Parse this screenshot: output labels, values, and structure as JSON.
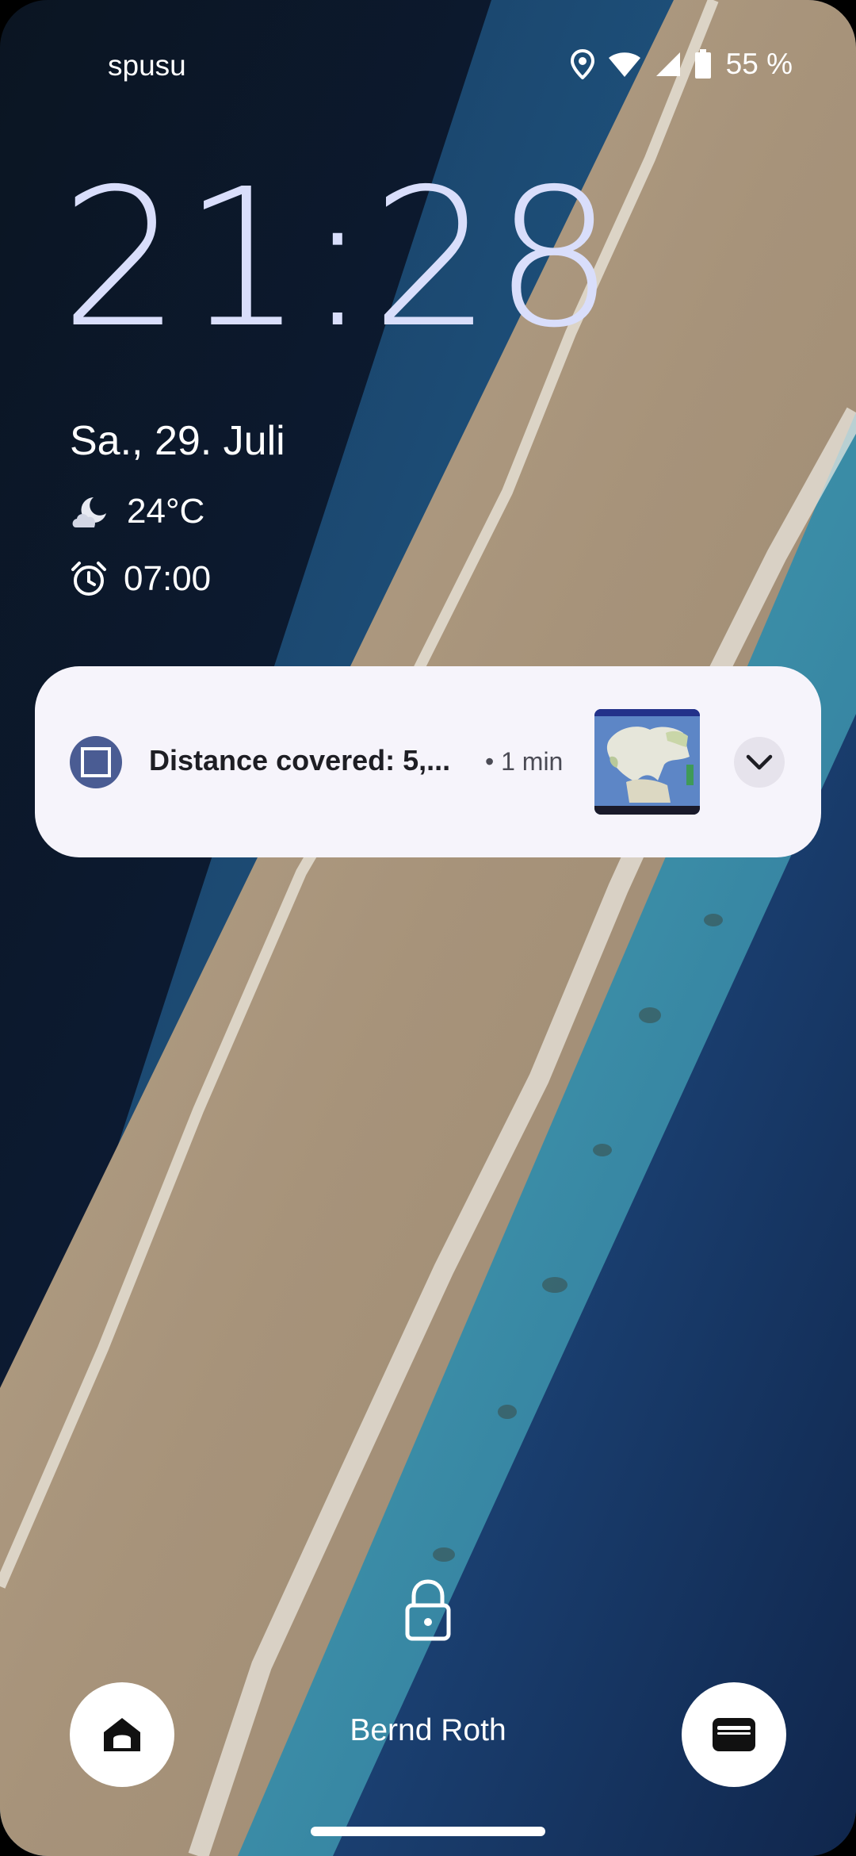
{
  "status_bar": {
    "carrier": "spusu",
    "battery_level": "55 %",
    "icons": [
      "location-icon",
      "wifi-icon",
      "cell-signal-icon",
      "battery-icon"
    ]
  },
  "lockscreen": {
    "time": "21:28",
    "date": "Sa., 29. Juli",
    "weather": {
      "icon": "moon-cloud-icon",
      "temperature": "24°C"
    },
    "alarm": {
      "icon": "alarm-clock-icon",
      "time": "07:00"
    },
    "owner_name": "Bernd Roth"
  },
  "notification": {
    "app_icon": "stop-square-icon",
    "title": "Distance covered: 5,...",
    "time": "• 1 min",
    "thumbnail": "map-thumbnail",
    "expand_icon": "chevron-down-icon"
  },
  "shortcuts": {
    "left": "home-icon",
    "right": "wallet-icon"
  },
  "colors": {
    "clock": "#d9defb",
    "notification_bg": "#f6f4fb",
    "notification_app_icon": "#4a5c93",
    "shortcut_bg": "#ffffff"
  }
}
